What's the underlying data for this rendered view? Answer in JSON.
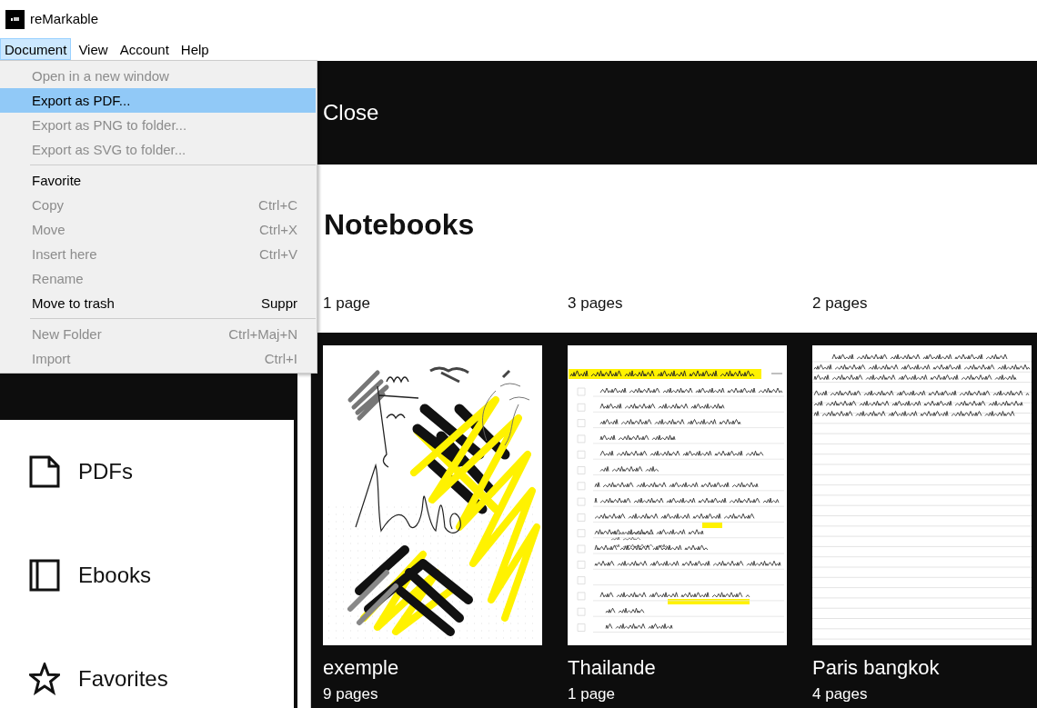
{
  "window": {
    "title": "reMarkable"
  },
  "menu_bar": [
    {
      "label": "Document",
      "selected": true
    },
    {
      "label": "View",
      "selected": false
    },
    {
      "label": "Account",
      "selected": false
    },
    {
      "label": "Help",
      "selected": false
    }
  ],
  "menu": {
    "items": [
      {
        "kind": "item",
        "label": "Open in a new window",
        "disabled": true,
        "highlighted": false
      },
      {
        "kind": "item",
        "label": "Export as PDF...",
        "disabled": false,
        "highlighted": true
      },
      {
        "kind": "item",
        "label": "Export as PNG to folder...",
        "disabled": true,
        "highlighted": false
      },
      {
        "kind": "item",
        "label": "Export as SVG to folder...",
        "disabled": true,
        "highlighted": false
      },
      {
        "kind": "separator"
      },
      {
        "kind": "item",
        "label": "Favorite",
        "disabled": false,
        "highlighted": false
      },
      {
        "kind": "item",
        "label": "Copy",
        "shortcut": "Ctrl+C",
        "disabled": true,
        "highlighted": false
      },
      {
        "kind": "item",
        "label": "Move",
        "shortcut": "Ctrl+X",
        "disabled": true,
        "highlighted": false
      },
      {
        "kind": "item",
        "label": "Insert here",
        "shortcut": "Ctrl+V",
        "disabled": true,
        "highlighted": false
      },
      {
        "kind": "item",
        "label": "Rename",
        "disabled": true,
        "highlighted": false
      },
      {
        "kind": "item",
        "label": "Move to trash",
        "shortcut": "Suppr",
        "disabled": false,
        "highlighted": false
      },
      {
        "kind": "separator"
      },
      {
        "kind": "item",
        "label": "New Folder",
        "shortcut": "Ctrl+Maj+N",
        "disabled": true,
        "highlighted": false
      },
      {
        "kind": "item",
        "label": "Import",
        "shortcut": "Ctrl+I",
        "disabled": true,
        "highlighted": false
      }
    ]
  },
  "sidebar": {
    "items": [
      {
        "selected": true
      },
      {
        "kind": "page",
        "label": "PDFs",
        "selected": false
      },
      {
        "kind": "book",
        "label": "Ebooks",
        "selected": false
      },
      {
        "kind": "star",
        "label": "Favorites",
        "selected": false
      }
    ]
  },
  "toolbar": {
    "close_button": "Close"
  },
  "section": {
    "title": "Notebooks"
  },
  "folders": [
    {
      "pages": "1 page"
    },
    {
      "pages": "3 pages"
    },
    {
      "pages": "2 pages"
    }
  ],
  "notebooks": [
    {
      "title": "exemple",
      "pages": "9 pages",
      "kind": "sketch"
    },
    {
      "title": "Thailande",
      "pages": "1 page",
      "kind": "checklist"
    },
    {
      "title": "Paris bangkok",
      "pages": "4 pages",
      "kind": "lined"
    }
  ]
}
